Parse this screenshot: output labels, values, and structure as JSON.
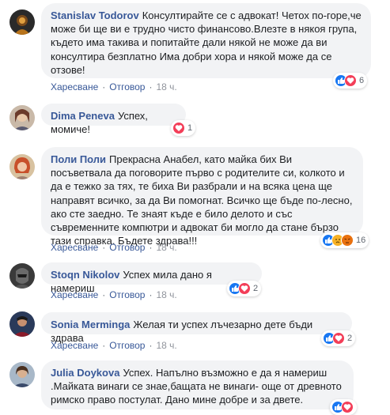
{
  "ui": {
    "like": "Харесване",
    "reply": "Отговор",
    "dot": "·"
  },
  "comments": [
    {
      "author": "Stanislav Todorov",
      "text": "Консултирайте се с адвокат! Четох по-горе,че може би ще ви е трудно чисто финансово.Влезте в някоя група, където има такива и попитайте дали някой не може да ви консултира безплатно Има добри хора и някой може да се отзове!",
      "time": "18 ч.",
      "reactions": [
        "like",
        "love"
      ],
      "count": "6"
    },
    {
      "author": "Dima Peneva",
      "text": "Успех, момиче!",
      "reactions": [
        "love"
      ],
      "count": "1"
    },
    {
      "author": "Поли Поли",
      "text": "Прекрасна Анабел, като майка бих Ви посъветвала да поговорите първо с родителите си, колкото и да е тежко за тях, те биха Ви разбрали и на всяка цена ще направят всичко, за да Ви помогнат. Всичко ще бъде по-лесно, ако сте заедно. Те знаят къде е било делото и със съвременните компютри и адвокат би могло да стане бързо тази справка. Бъдете здрава!!!",
      "time": "18 ч.",
      "reactions": [
        "like",
        "sad",
        "angry"
      ],
      "count": "16"
    },
    {
      "author": "Stoqn Nikolov",
      "text": "Успех мила дано я намериш",
      "time": "18 ч.",
      "reactions": [
        "like",
        "love"
      ],
      "count": "2"
    },
    {
      "author": "Sonia Merminga",
      "text": "Желая ти успех лъчезарно дете бъди здрава",
      "time": "18 ч.",
      "reactions": [
        "like",
        "love"
      ],
      "count": "2"
    },
    {
      "author": "Julia Doykova",
      "text": "Успех. Напълно възможно е да я намериш .Майката винаги се знае,бащата не винаги- още от древното римско право постулат. Дано мине добре и за двете.",
      "reactions": [
        "like",
        "love"
      ]
    }
  ],
  "colors": {
    "author": "#385898",
    "bubble": "#f2f3f5",
    "like": "#1877f2",
    "love": "#f33e58"
  }
}
